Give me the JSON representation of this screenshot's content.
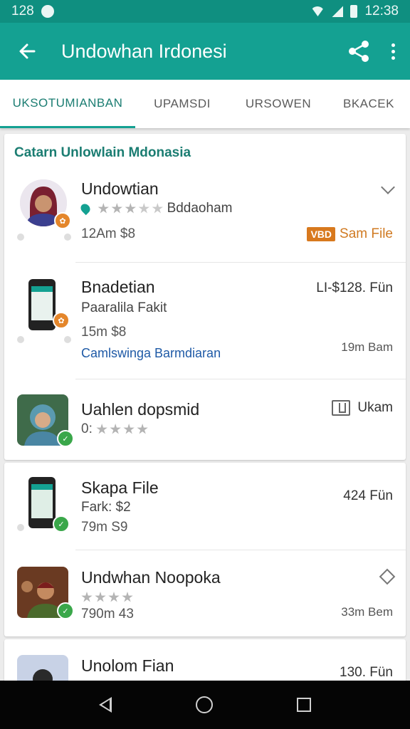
{
  "status_bar": {
    "time_left": "128",
    "time_right": "12:38"
  },
  "app_bar": {
    "title": "Undowhan Irdonesi"
  },
  "tabs": [
    {
      "label": "UKSOTUMIANBAN",
      "active": true
    },
    {
      "label": "UPAMSDI",
      "active": false
    },
    {
      "label": "URSOWEN",
      "active": false
    },
    {
      "label": "BKACEK",
      "active": false
    }
  ],
  "section_title": "Catarn Unlowlain Mdonasia",
  "items": [
    {
      "name": "Undowtian",
      "location": "Bddaoham",
      "rating": 3,
      "meta": "12Am $8",
      "right_tag": "VBD",
      "right_text": "Sam File"
    },
    {
      "name": "Bnadetian",
      "subtitle": "Paaralila Fakit",
      "meta": "15m $8",
      "link": "Camlswinga Barmdiaran",
      "right_text": "LI-$128. Fün",
      "right_small": "19m Bam"
    },
    {
      "name": "Uahlen dopsmid",
      "meta_prefix": "0:",
      "rating": 4,
      "right_text": "Ukam"
    },
    {
      "name": "Skapa File",
      "subtitle": "Fark: $2",
      "meta": "79m S9",
      "right_text": "424 Fün"
    },
    {
      "name": "Undwhan Noopoka",
      "rating": 4,
      "meta": "790m 43",
      "right_small": "33m Bem"
    },
    {
      "name": "Unolom Fian",
      "right_text": "130. Fün"
    }
  ],
  "colors": {
    "teal": "#14a192",
    "teal_dark": "#0f8f80",
    "orange": "#d8791e",
    "link_blue": "#1f5aa6"
  }
}
